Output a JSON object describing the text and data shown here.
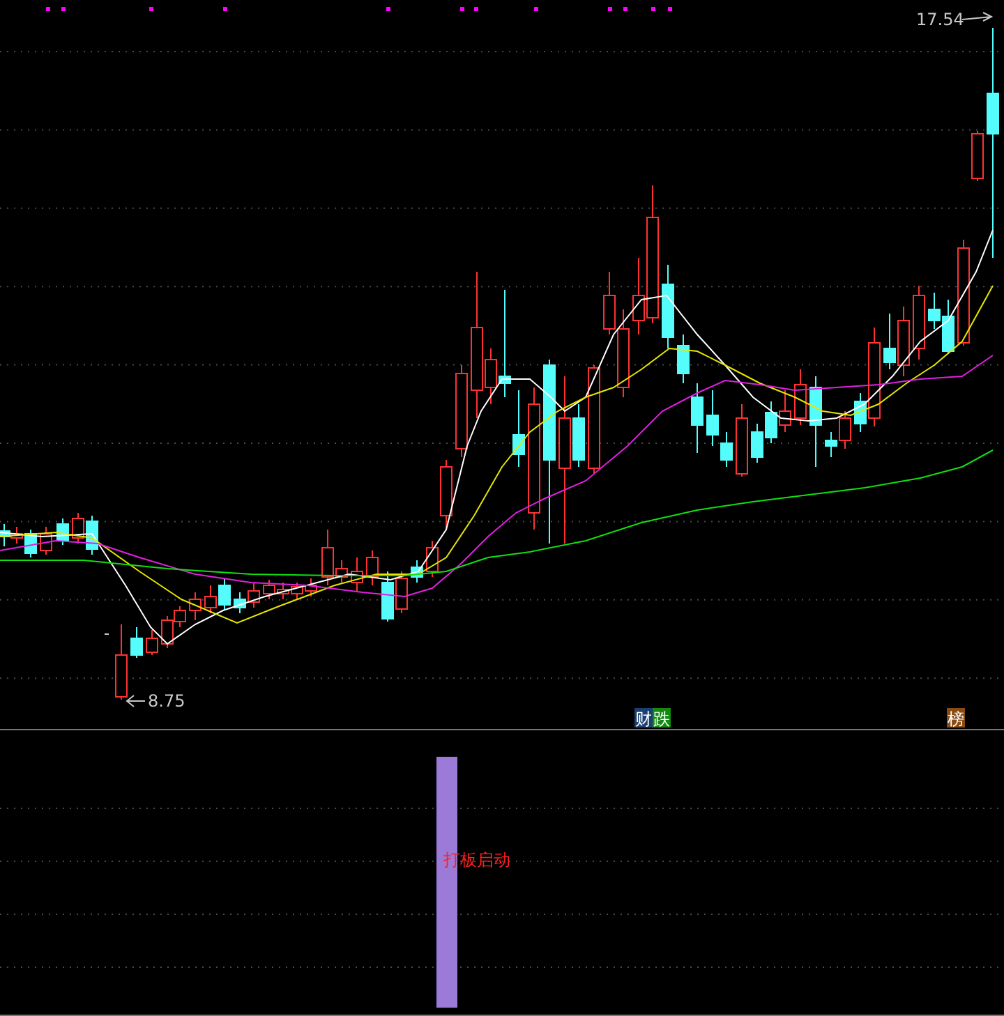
{
  "price_labels": {
    "high": "17.54",
    "low": "8.75"
  },
  "event_tags": [
    {
      "text": "财",
      "color": "#1b3f73"
    },
    {
      "text": "跌",
      "color": "#128a12"
    },
    {
      "text": "榜",
      "color": "#8a4b12"
    }
  ],
  "signal": {
    "label": "打板启动"
  }
}
